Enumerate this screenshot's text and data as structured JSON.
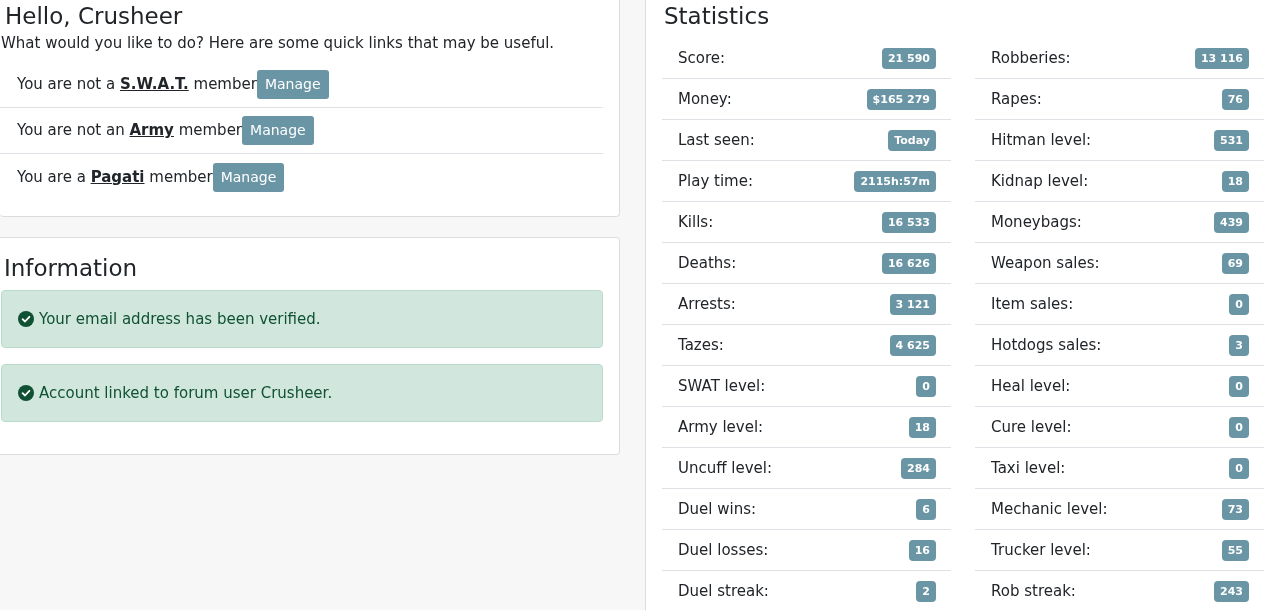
{
  "greeting": {
    "title": "Hello, Crusheer",
    "subtitle": "What would you like to do? Here are some quick links that may be useful."
  },
  "memberships": [
    {
      "before": "You are not a",
      "group": "S.W.A.T.",
      "after": "member",
      "button": "Manage"
    },
    {
      "before": "You are not an",
      "group": "Army",
      "after": "member",
      "button": "Manage"
    },
    {
      "before": "You are a",
      "group": "Pagati",
      "after": "member",
      "button": "Manage"
    }
  ],
  "information": {
    "title": "Information",
    "alerts": [
      {
        "kind": "success",
        "text": "Your email address has been verified."
      },
      {
        "kind": "success",
        "text": "Account linked to forum user Crusheer."
      }
    ]
  },
  "statistics": {
    "title": "Statistics",
    "columns": [
      [
        {
          "label": "Score:",
          "value": "21 590"
        },
        {
          "label": "Money:",
          "value": "$165 279"
        },
        {
          "label": "Last seen:",
          "value": "Today"
        },
        {
          "label": "Play time:",
          "value": "2115h:57m"
        },
        {
          "label": "Kills:",
          "value": "16 533"
        },
        {
          "label": "Deaths:",
          "value": "16 626"
        },
        {
          "label": "Arrests:",
          "value": "3 121"
        },
        {
          "label": "Tazes:",
          "value": "4 625"
        },
        {
          "label": "SWAT level:",
          "value": "0"
        },
        {
          "label": "Army level:",
          "value": "18"
        },
        {
          "label": "Uncuff level:",
          "value": "284"
        },
        {
          "label": "Duel wins:",
          "value": "6"
        },
        {
          "label": "Duel losses:",
          "value": "16"
        },
        {
          "label": "Duel streak:",
          "value": "2"
        }
      ],
      [
        {
          "label": "Robberies:",
          "value": "13 116"
        },
        {
          "label": "Rapes:",
          "value": "76"
        },
        {
          "label": "Hitman level:",
          "value": "531"
        },
        {
          "label": "Kidnap level:",
          "value": "18"
        },
        {
          "label": "Moneybags:",
          "value": "439"
        },
        {
          "label": "Weapon sales:",
          "value": "69"
        },
        {
          "label": "Item sales:",
          "value": "0"
        },
        {
          "label": "Hotdogs sales:",
          "value": "3"
        },
        {
          "label": "Heal level:",
          "value": "0"
        },
        {
          "label": "Cure level:",
          "value": "0"
        },
        {
          "label": "Taxi level:",
          "value": "0"
        },
        {
          "label": "Mechanic level:",
          "value": "73"
        },
        {
          "label": "Trucker level:",
          "value": "55"
        },
        {
          "label": "Rob streak:",
          "value": "243"
        }
      ]
    ]
  }
}
